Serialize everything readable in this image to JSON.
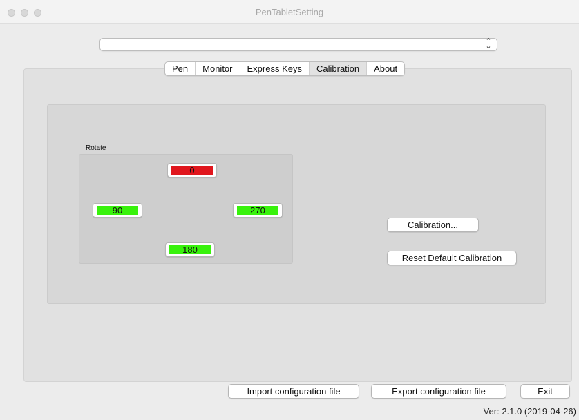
{
  "window": {
    "title": "PenTabletSetting"
  },
  "device_select": {
    "value": ""
  },
  "tabs": [
    {
      "label": "Pen",
      "selected": false
    },
    {
      "label": "Monitor",
      "selected": false
    },
    {
      "label": "Express Keys",
      "selected": false
    },
    {
      "label": "Calibration",
      "selected": true
    },
    {
      "label": "About",
      "selected": false
    }
  ],
  "rotate": {
    "label": "Rotate",
    "options": [
      {
        "label": "0",
        "color": "#e0161d",
        "selected": true
      },
      {
        "label": "90",
        "color": "#38f20c",
        "selected": false
      },
      {
        "label": "270",
        "color": "#38f20c",
        "selected": false
      },
      {
        "label": "180",
        "color": "#38f20c",
        "selected": false
      }
    ]
  },
  "calibration": {
    "calibrate_label": "Calibration...",
    "reset_label": "Reset Default Calibration"
  },
  "footer": {
    "import_label": "Import configuration file",
    "export_label": "Export configuration file",
    "exit_label": "Exit",
    "version": "Ver: 2.1.0 (2019-04-26)"
  },
  "colors": {
    "selected_rotation": "#e0161d",
    "unselected_rotation": "#38f20c",
    "window_background": "#ececec"
  }
}
